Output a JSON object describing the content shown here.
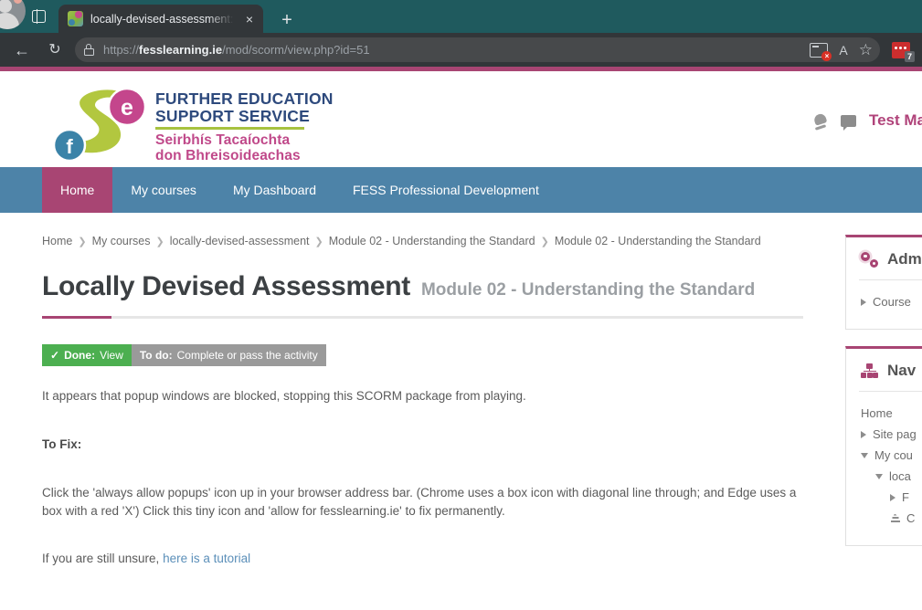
{
  "browser": {
    "tab": {
      "title": "locally-devised-assessment: Mod",
      "favicon": "fess-logo-favicon",
      "close_label": "×"
    },
    "new_tab_label": "+",
    "back_label": "←",
    "reload_label": "↻",
    "address": {
      "scheme": "https://",
      "domain": "fesslearning.ie",
      "path": "/mod/scorm/view.php?id=51",
      "lock_icon": "lock-icon"
    },
    "popup_blocked_icon": "popup-blocked-icon",
    "popup_blocked_badge": "×",
    "read_aloud_label": "A",
    "favorite_label": "☆",
    "extension_badge": "7"
  },
  "header": {
    "logo": {
      "line1": "FURTHER EDUCATION\nSUPPORT SERVICE",
      "line1a": "FURTHER EDUCATION",
      "line1b": "SUPPORT SERVICE",
      "line2a": "Seirbhís Tacaíochta",
      "line2b": "don Bhreisoideachas",
      "letter_f": "f",
      "letter_e": "e"
    },
    "notifications_icon": "bell-icon",
    "messages_icon": "message-icon",
    "username": "Test Ma"
  },
  "nav": {
    "items": [
      {
        "label": "Home",
        "active": true
      },
      {
        "label": "My courses",
        "active": false
      },
      {
        "label": "My Dashboard",
        "active": false
      },
      {
        "label": "FESS Professional Development",
        "active": false
      }
    ]
  },
  "breadcrumb": {
    "separator": "❯",
    "items": [
      "Home",
      "My courses",
      "locally-devised-assessment",
      "Module 02 - Understanding the Standard",
      "Module 02 - Understanding the Standard"
    ]
  },
  "main": {
    "title": "Locally Devised Assessment",
    "subtitle": "Module 02 - Understanding the Standard",
    "badges": {
      "done": {
        "check": "✓",
        "bold": "Done:",
        "rest": "View"
      },
      "todo": {
        "bold": "To do:",
        "rest": "Complete or pass the activity"
      }
    },
    "paragraph1": "It appears that popup windows are blocked, stopping this SCORM package from playing.",
    "heading_tofix": "To Fix:",
    "paragraph2": "Click the 'always allow popups' icon up in your browser address bar. (Chrome uses a box icon with diagonal line through; and Edge uses a box with a red 'X') Click this tiny icon and 'allow for fesslearning.ie' to fix permanently.",
    "paragraph3_prefix": "If you are still unsure, ",
    "paragraph3_link": "here is a tutorial"
  },
  "sidebar": {
    "admin_block": {
      "icon": "gears-icon",
      "title": "Adm",
      "items": [
        {
          "label": "Course",
          "state": "collapsed",
          "depth": 1
        }
      ]
    },
    "nav_block": {
      "icon": "sitemap-icon",
      "title": "Nav",
      "items": [
        {
          "label": "Home",
          "state": "leaf",
          "depth": 0
        },
        {
          "label": "Site pag",
          "state": "collapsed",
          "depth": 1
        },
        {
          "label": "My cou",
          "state": "expanded",
          "depth": 1
        },
        {
          "label": "loca",
          "state": "expanded",
          "depth": 2
        },
        {
          "label": "F",
          "state": "collapsed",
          "depth": 3
        },
        {
          "label": "C",
          "state": "activity",
          "depth": 3
        }
      ]
    }
  },
  "colors": {
    "accent_maroon": "#a84573",
    "nav_blue": "#4d83a8",
    "teal": "#1f5a5e",
    "done_green": "#4caf50",
    "todo_gray": "#9a9a9a",
    "link_blue": "#5b8fb9"
  }
}
